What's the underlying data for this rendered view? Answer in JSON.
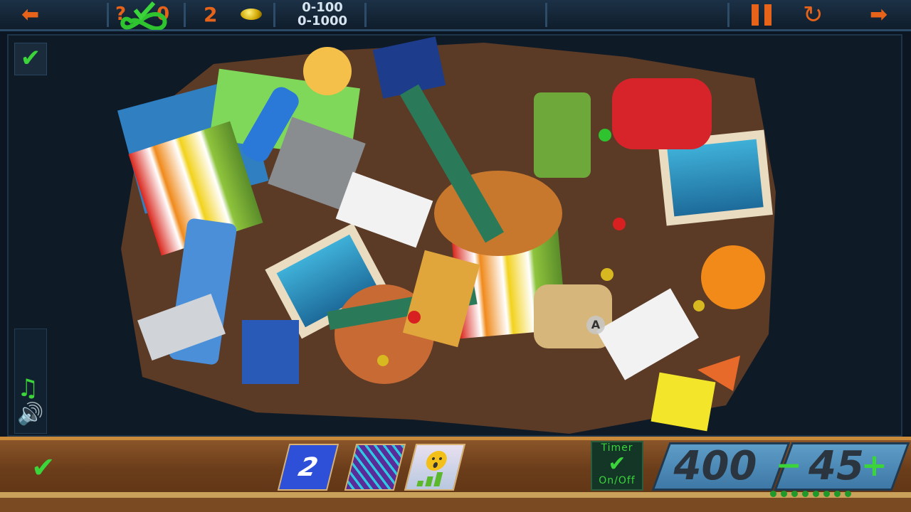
{
  "topbar": {
    "question_mark": "?",
    "hint_count_fragment": "0",
    "found_count": "2",
    "range_line1": "0-100",
    "range_line2": "0-1000"
  },
  "icons": {
    "back": "arrow-left-icon",
    "infinity": "infinity-icon",
    "coin": "coin-icon",
    "pause": "pause-icon",
    "restart": "restart-icon",
    "forward": "arrow-right-icon",
    "check": "checkmark-icon",
    "music": "music-note-icon",
    "sound": "speaker-icon"
  },
  "board": {
    "hint_marker": "A"
  },
  "bottombar": {
    "powerup_number": "2",
    "timer_label_top": "Timer",
    "timer_label_bottom": "On/Off",
    "score": "400",
    "minus": "−",
    "level": "45",
    "plus": "+"
  },
  "colors": {
    "accent_orange": "#e8631a",
    "accent_green": "#3bd43b"
  }
}
